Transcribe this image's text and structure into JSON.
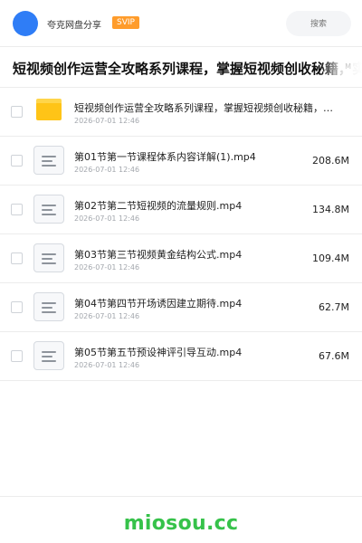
{
  "header": {
    "share_name": "夸克网盘分享",
    "badge": "SVIP",
    "search_placeholder": "搜索"
  },
  "title_bar": {
    "title": "短视频创作运营全攻略系列课程，掌握短视频创收秘籍，实",
    "trailing_text": "M"
  },
  "items": [
    {
      "type": "folder",
      "icon": "folder-icon",
      "name": "短视频创作运营全攻略系列课程，掌握短视频创收秘籍，实现流量变现",
      "date": "2026-07-01 12:46",
      "size": ""
    },
    {
      "type": "file",
      "icon": "file-icon",
      "name": "第01节第一节课程体系内容详解(1).mp4",
      "date": "2026-07-01 12:46",
      "size": "208.6M"
    },
    {
      "type": "file",
      "icon": "file-icon",
      "name": "第02节第二节短视频的流量规则.mp4",
      "date": "2026-07-01 12:46",
      "size": "134.8M"
    },
    {
      "type": "file",
      "icon": "file-icon",
      "name": "第03节第三节视频黄金结构公式.mp4",
      "date": "2026-07-01 12:46",
      "size": "109.4M"
    },
    {
      "type": "file",
      "icon": "file-icon",
      "name": "第04节第四节开场诱因建立期待.mp4",
      "date": "2026-07-01 12:46",
      "size": "62.7M"
    },
    {
      "type": "file",
      "icon": "file-icon",
      "name": "第05节第五节预设神评引导互动.mp4",
      "date": "2026-07-01 12:46",
      "size": "67.6M"
    }
  ],
  "footer": {
    "brand": "miosou.cc",
    "brand_color": "#36c24a"
  },
  "colors": {
    "avatar": "#2f7df6",
    "badge": "#ff9c2b",
    "folder": "#ffc417"
  }
}
